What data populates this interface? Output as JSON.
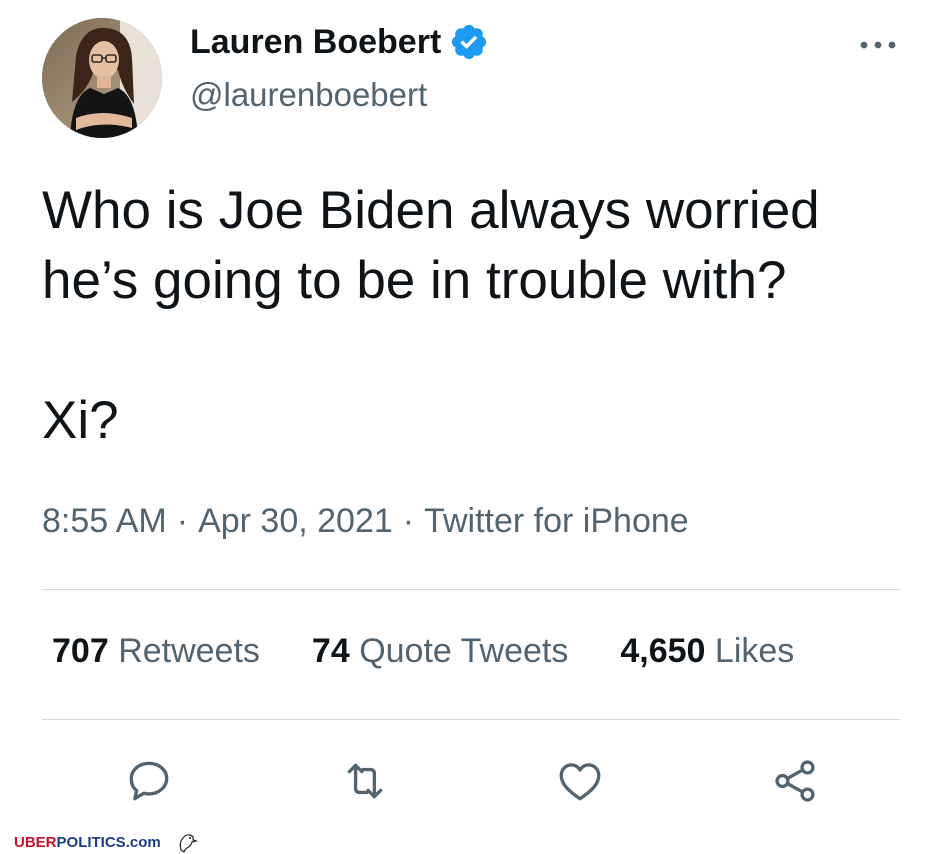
{
  "author": {
    "display_name": "Lauren Boebert",
    "handle": "@laurenboebert",
    "verified": true
  },
  "tweet": {
    "text": "Who is Joe Biden always worried\nhe’s going to be in trouble with?\n\nXi?",
    "time": "8:55 AM",
    "date": "Apr 30, 2021",
    "source": "Twitter for iPhone",
    "separator": "·"
  },
  "stats": {
    "retweets_count": "707",
    "retweets_label": "Retweets",
    "quotes_count": "74",
    "quotes_label": "Quote Tweets",
    "likes_count": "4,650",
    "likes_label": "Likes"
  },
  "icons": {
    "reply": "reply-icon",
    "retweet": "retweet-icon",
    "like": "heart-icon",
    "share": "share-icon",
    "more": "more-icon",
    "verified": "verified-badge-icon"
  },
  "watermark": {
    "uber": "UBER",
    "politics": "POLITICS",
    "domain": ".com"
  },
  "colors": {
    "verified_blue": "#1d9bf0",
    "text_primary": "#0f1419",
    "text_secondary": "#536471",
    "divider": "#cfd9de",
    "watermark_red": "#c8102e",
    "watermark_blue": "#1a3a8a"
  }
}
